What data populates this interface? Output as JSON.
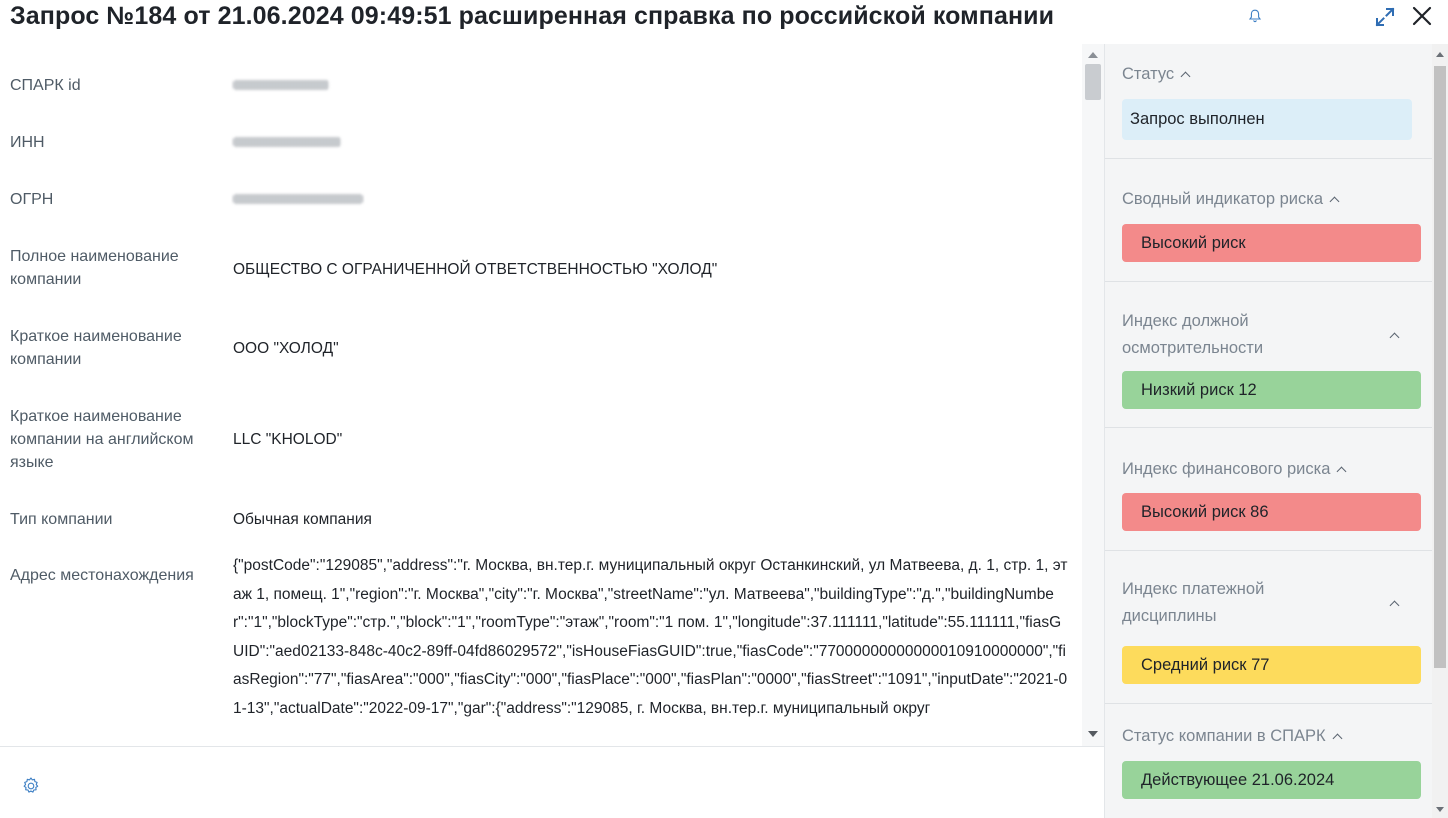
{
  "header": {
    "title": "Запрос №184 от 21.06.2024 09:49:51 расширенная справка по российской компании",
    "bell_icon": "bell-icon",
    "expand_icon": "expand-icon",
    "close_icon": "close-icon"
  },
  "fields": [
    {
      "label": "СПАРК id",
      "value": "",
      "blurred": true
    },
    {
      "label": "ИНН",
      "value": "",
      "blurred": true
    },
    {
      "label": "ОГРН",
      "value": "",
      "blurred": true
    },
    {
      "label": "Полное наименование компании",
      "value": "ОБЩЕСТВО С ОГРАНИЧЕННОЙ ОТВЕТСТВЕННОСТЬЮ \"ХОЛОД\""
    },
    {
      "label": "Краткое наименование компании",
      "value": "ООО \"ХОЛОД\""
    },
    {
      "label": "Краткое наименование компании на английском языке",
      "value": "LLC \"KHOLOD\""
    },
    {
      "label": "Тип компании",
      "value": "Обычная компания"
    },
    {
      "label": "Адрес местонахождения",
      "value": "{\"postCode\":\"129085\",\"address\":\"г. Москва, вн.тер.г. муниципальный округ Останкинский, ул Матвеева, д. 1, стр. 1, этаж 1, помещ. 1\",\"region\":\"г. Москва\",\"city\":\"г. Москва\",\"streetName\":\"ул. Матвеева\",\"buildingType\":\"д.\",\"buildingNumber\":\"1\",\"blockType\":\"стр.\",\"block\":\"1\",\"roomType\":\"этаж\",\"room\":\"1 пом. 1\",\"longitude\":37.111111,\"latitude\":55.111111,\"fiasGUID\":\"aed02133-848c-40c2-89ff-04fd86029572\",\"isHouseFiasGUID\":true,\"fiasCode\":\"77000000000000010910000000\",\"fiasRegion\":\"77\",\"fiasArea\":\"000\",\"fiasCity\":\"000\",\"fiasPlace\":\"000\",\"fiasPlan\":\"0000\",\"fiasStreet\":\"1091\",\"inputDate\":\"2021-01-13\",\"actualDate\":\"2022-09-17\",\"gar\":{\"address\":\"129085, г. Москва, вн.тер.г. муниципальный округ"
    }
  ],
  "footer": {
    "settings_icon": "gear-icon"
  },
  "sidebar": {
    "sections": [
      {
        "title": "Статус",
        "badge": "Запрос выполнен",
        "color": "#dceef8"
      },
      {
        "title": "Сводный индикатор риска",
        "badge": "Высокий риск",
        "color": "#f38a8a"
      },
      {
        "title": "Индекс должной осмотрительности",
        "badge": "Низкий риск 12",
        "color": "#98d39a"
      },
      {
        "title": "Индекс финансового риска",
        "badge": "Высокий риск 86",
        "color": "#f38a8a"
      },
      {
        "title": "Индекс платежной дисциплины",
        "badge": "Средний риск 77",
        "color": "#fddb5c"
      },
      {
        "title": "Статус компании в СПАРК",
        "badge": "Действующее 21.06.2024",
        "color": "#98d39a"
      }
    ]
  }
}
